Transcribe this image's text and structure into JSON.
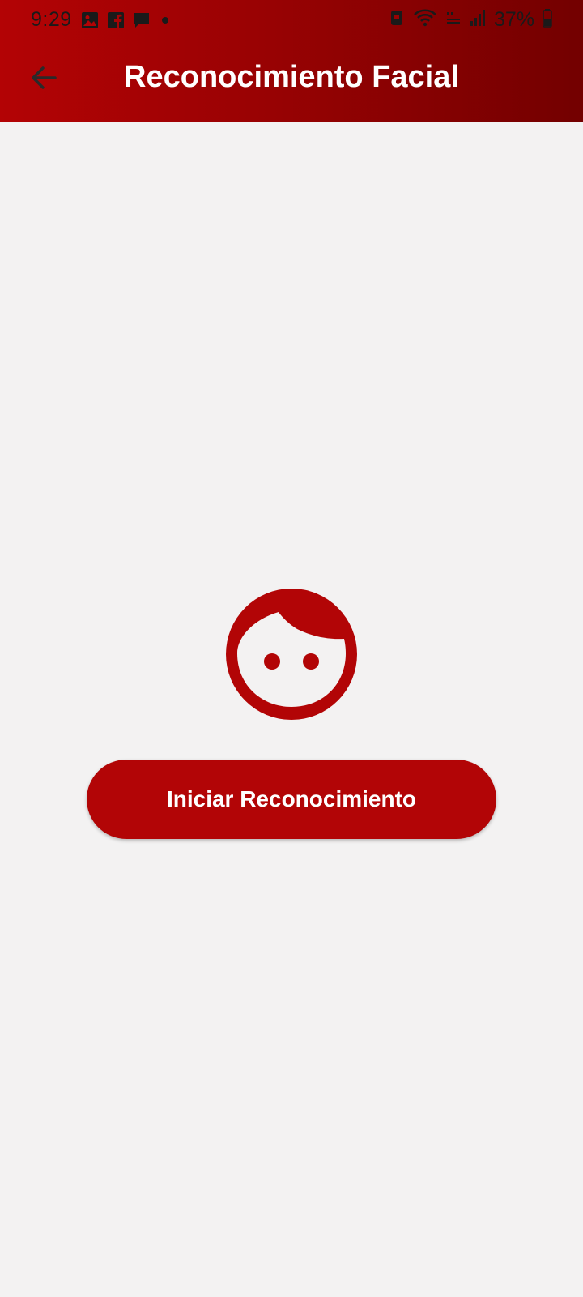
{
  "status_bar": {
    "time": "9:29",
    "battery": "37%",
    "left_icons": [
      "gallery-icon",
      "facebook-icon",
      "message-icon",
      "dot-icon"
    ],
    "right_icons": [
      "alarm-icon",
      "wifi-icon",
      "volte-icon",
      "signal-icon",
      "battery-icon"
    ]
  },
  "toolbar": {
    "title": "Reconocimiento Facial",
    "back_icon": "arrow-back-icon"
  },
  "main": {
    "icon": "face-icon",
    "start_button_label": "Iniciar Reconocimiento"
  },
  "colors": {
    "primary": "#b20506",
    "primary_dark": "#730000",
    "background": "#f3f2f2"
  }
}
